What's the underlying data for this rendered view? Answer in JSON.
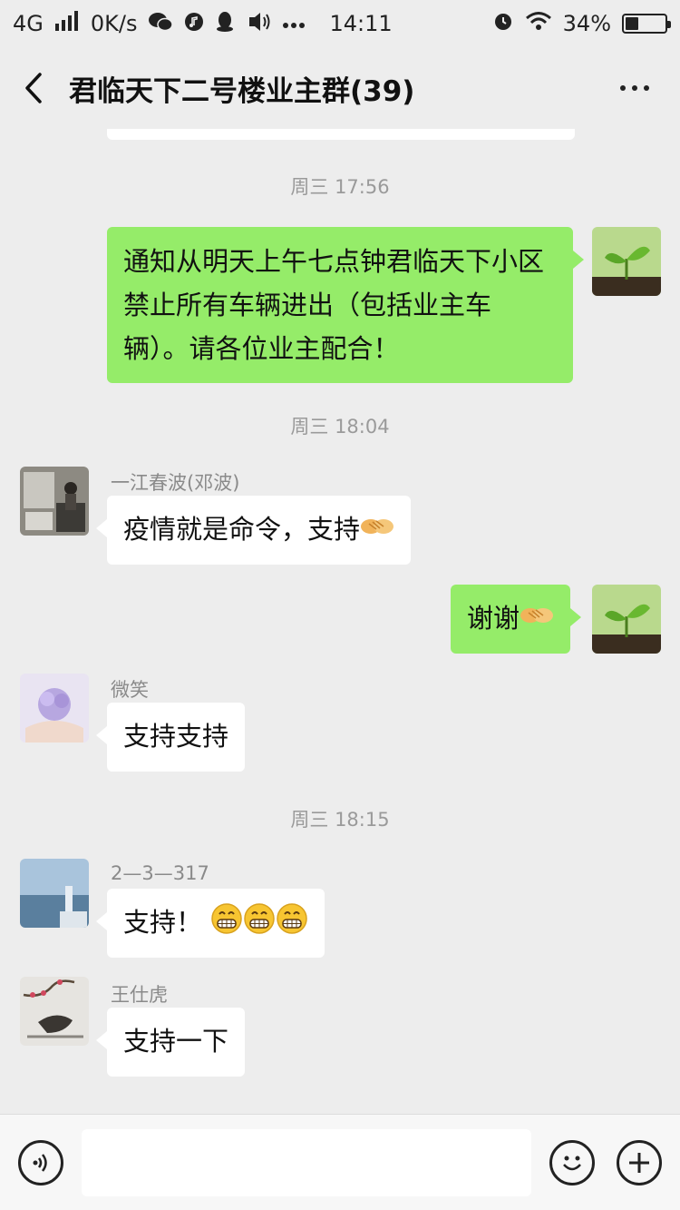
{
  "status_bar": {
    "network": "4G",
    "speed": "0K/s",
    "time": "14:11",
    "battery_text": "34%",
    "battery_level": 0.34,
    "icons": [
      "signal-icon",
      "wechat-icon",
      "music-icon",
      "qq-icon",
      "vibrate-icon",
      "more-notifications-icon",
      "alarm-icon",
      "wifi-icon",
      "battery-icon"
    ]
  },
  "header": {
    "title": "君临天下二号楼业主群(39)",
    "back_icon": "back-arrow-icon",
    "more_icon": "more-dots-icon"
  },
  "messages": [
    {
      "type": "timestamp",
      "text": "周三 17:56"
    },
    {
      "type": "message",
      "direction": "out",
      "avatar": "seedling-avatar",
      "text": "通知从明天上午七点钟君临天下小区禁止所有车辆进出（包括业主车辆）。请各位业主配合！"
    },
    {
      "type": "timestamp",
      "text": "周三 18:04"
    },
    {
      "type": "message",
      "direction": "in",
      "sender": "一江春波(邓波)",
      "avatar": "room-photo-avatar",
      "text": "疫情就是命令，支持",
      "emoji": "handshake-emoji"
    },
    {
      "type": "message",
      "direction": "out",
      "avatar": "seedling-avatar",
      "text": "谢谢",
      "emoji": "handshake-emoji"
    },
    {
      "type": "message",
      "direction": "in",
      "sender": "微笑",
      "avatar": "flower-hands-avatar",
      "text": "支持支持"
    },
    {
      "type": "timestamp",
      "text": "周三 18:15"
    },
    {
      "type": "message",
      "direction": "in",
      "sender": "2—3—317",
      "avatar": "seaside-avatar",
      "text": "支持！",
      "emoji": "grin-emoji x3"
    },
    {
      "type": "message",
      "direction": "in",
      "sender": "王仕虎",
      "avatar": "plum-blossom-painting-avatar",
      "text": "支持一下"
    }
  ],
  "input_bar": {
    "voice_icon": "voice-input-icon",
    "emoji_icon": "emoji-icon",
    "plus_icon": "plus-icon",
    "placeholder": ""
  },
  "colors": {
    "chat_bg": "#ededed",
    "out_bubble": "#95ec69",
    "in_bubble": "#ffffff",
    "timestamp": "#9a9a9a"
  }
}
